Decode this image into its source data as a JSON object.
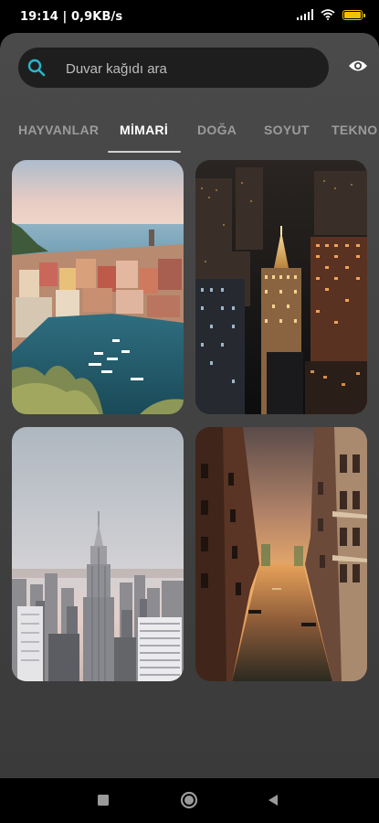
{
  "status_bar": {
    "time": "19:14 | 0,9KB/s"
  },
  "search": {
    "placeholder": "Duvar kağıdı ara"
  },
  "tabs": [
    {
      "label": "HAYVANLAR"
    },
    {
      "label": "MİMARİ"
    },
    {
      "label": "DOĞA"
    },
    {
      "label": "SOYUT"
    },
    {
      "label": "TEKNO"
    }
  ],
  "active_tab": "MİMARİ",
  "wallpapers": [
    {
      "subject": "coastal-village-harbor"
    },
    {
      "subject": "night-city-skyline"
    },
    {
      "subject": "empire-state-building"
    },
    {
      "subject": "venice-canal-sunset"
    }
  ],
  "colors": {
    "accent": "#29b6c9",
    "sheet": "#444444",
    "search_bg": "#1e1e1e"
  }
}
